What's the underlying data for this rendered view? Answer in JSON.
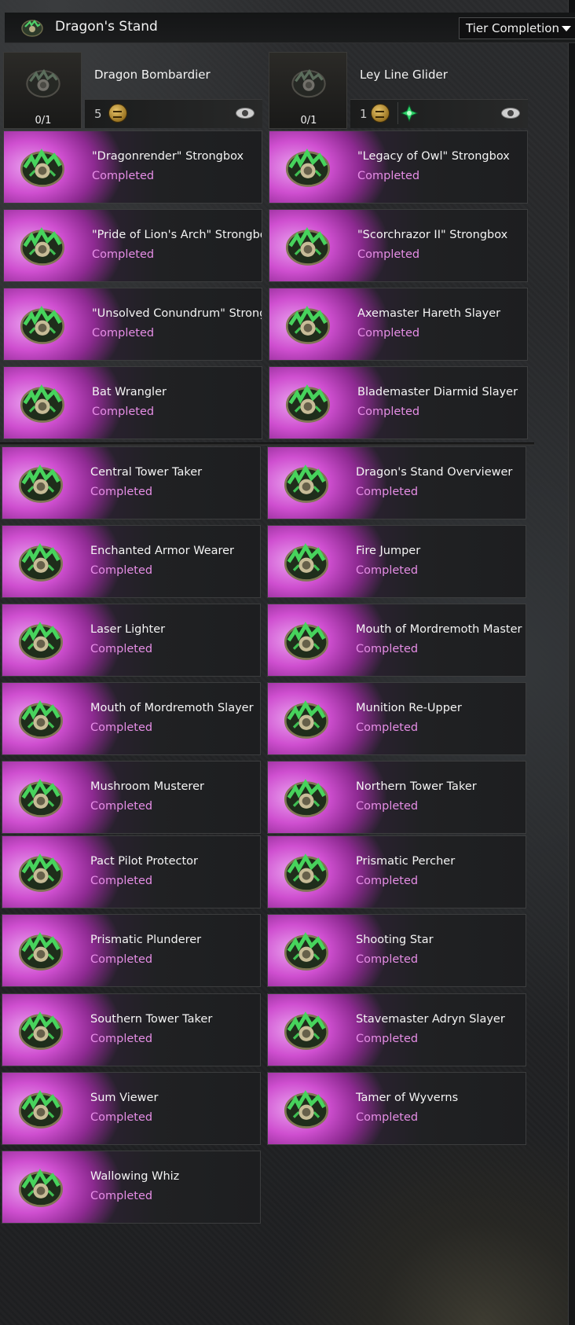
{
  "header": {
    "title": "Dragon's Stand",
    "icon": "achievement-category-icon",
    "dropdown": {
      "selected": "Tier Completion"
    }
  },
  "tracked": [
    {
      "name": "Dragon Bombardier",
      "progress": "0/1",
      "reward_count": "5",
      "rewards": [
        "mastery-coin-icon"
      ]
    },
    {
      "name": "Ley Line Glider",
      "progress": "0/1",
      "reward_count": "1",
      "rewards": [
        "mastery-coin-icon",
        "green-gem-icon"
      ]
    }
  ],
  "status_completed": "Completed",
  "colors": {
    "completed_text": "#e68ee6",
    "glow": "#cf4fd0"
  },
  "achievements": [
    {
      "name": "\"Dragonrender\" Strongbox",
      "status": "Completed"
    },
    {
      "name": "\"Legacy of Owl\" Strongbox",
      "status": "Completed"
    },
    {
      "name": "\"Pride of Lion's Arch\" Strongbox",
      "status": "Completed"
    },
    {
      "name": "\"Scorchrazor II\" Strongbox",
      "status": "Completed"
    },
    {
      "name": "\"Unsolved Conundrum\" Strongbox",
      "status": "Completed"
    },
    {
      "name": "Axemaster Hareth Slayer",
      "status": "Completed"
    },
    {
      "name": "Bat Wrangler",
      "status": "Completed"
    },
    {
      "name": "Blademaster Diarmid Slayer",
      "status": "Completed"
    },
    {
      "name": "Central Tower Taker",
      "status": "Completed"
    },
    {
      "name": "Dragon's Stand Overviewer",
      "status": "Completed"
    },
    {
      "name": "Enchanted Armor Wearer",
      "status": "Completed"
    },
    {
      "name": "Fire Jumper",
      "status": "Completed"
    },
    {
      "name": "Laser Lighter",
      "status": "Completed"
    },
    {
      "name": "Mouth of Mordremoth Master",
      "status": "Completed"
    },
    {
      "name": "Mouth of Mordremoth Slayer",
      "status": "Completed"
    },
    {
      "name": "Munition Re-Upper",
      "status": "Completed"
    },
    {
      "name": "Mushroom Musterer",
      "status": "Completed"
    },
    {
      "name": "Northern Tower Taker",
      "status": "Completed"
    },
    {
      "name": "Pact Pilot Protector",
      "status": "Completed"
    },
    {
      "name": "Prismatic Percher",
      "status": "Completed"
    },
    {
      "name": "Prismatic Plunderer",
      "status": "Completed"
    },
    {
      "name": "Shooting Star",
      "status": "Completed"
    },
    {
      "name": "Southern Tower Taker",
      "status": "Completed"
    },
    {
      "name": "Stavemaster Adryn Slayer",
      "status": "Completed"
    },
    {
      "name": "Sum Viewer",
      "status": "Completed"
    },
    {
      "name": "Tamer of Wyverns",
      "status": "Completed"
    },
    {
      "name": "Wallowing Whiz",
      "status": "Completed"
    }
  ]
}
